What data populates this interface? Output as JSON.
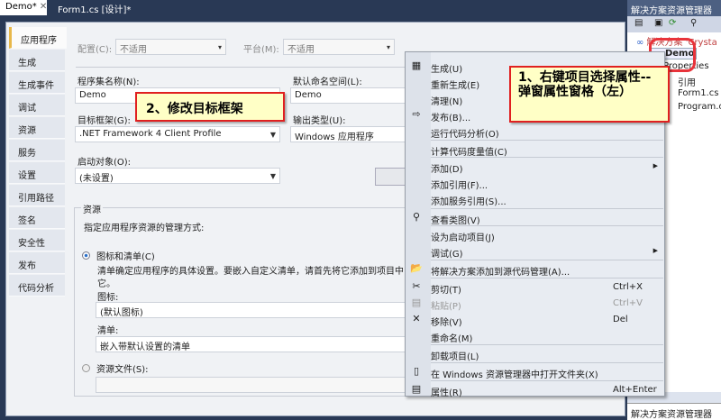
{
  "doc_tabs": [
    {
      "label": "Demo*",
      "close": "✕"
    },
    {
      "label": "Form1.cs [设计]*"
    }
  ],
  "side_tabs": [
    "应用程序",
    "生成",
    "生成事件",
    "调试",
    "资源",
    "服务",
    "设置",
    "引用路径",
    "签名",
    "安全性",
    "发布",
    "代码分析"
  ],
  "config": {
    "label": "配置(C):",
    "value": "不适用"
  },
  "platform": {
    "label": "平台(M):",
    "value": "不适用"
  },
  "assembly_name": {
    "label": "程序集名称(N):",
    "value": "Demo"
  },
  "default_namespace": {
    "label": "默认命名空间(L):",
    "value": "Demo"
  },
  "target_framework": {
    "label": "目标框架(G):",
    "value": ".NET Framework 4 Client Profile"
  },
  "output_type": {
    "label": "输出类型(U):",
    "value": "Windows 应用程序"
  },
  "startup_object": {
    "label": "启动对象(O):",
    "value": "(未设置)"
  },
  "resources": {
    "group": "资源",
    "desc": "指定应用程序资源的管理方式:",
    "radio_icon_manifest": "图标和清单(C)",
    "manifest_desc": "清单确定应用程序的具体设置。要嵌入自定义清单，请首先将它添加到项目中，然后",
    "manifest_desc2": "它。",
    "icon_label": "图标:",
    "icon_value": "(默认图标)",
    "manifest_label": "清单:",
    "manifest_value": "嵌入带默认设置的清单",
    "radio_resource_file": "资源文件(S):"
  },
  "context_menu": {
    "items": [
      {
        "label": "生成(U)",
        "icon": "build-icon"
      },
      {
        "label": "重新生成(E)"
      },
      {
        "label": "清理(N)"
      },
      {
        "label": "发布(B)...",
        "icon": "publish-icon"
      },
      {
        "label": "运行代码分析(O)"
      },
      {
        "label": "计算代码度量值(C)"
      },
      {
        "label": "添加(D)",
        "submenu": true
      },
      {
        "label": "添加引用(F)..."
      },
      {
        "label": "添加服务引用(S)..."
      },
      {
        "label": "查看类图(V)",
        "icon": "class-diagram-icon"
      },
      {
        "label": "设为启动项目(J)"
      },
      {
        "label": "调试(G)",
        "submenu": true
      },
      {
        "label": "将解决方案添加到源代码管理(A)...",
        "icon": "folder-icon"
      },
      {
        "label": "剪切(T)",
        "shortcut": "Ctrl+X",
        "icon": "scissors-icon"
      },
      {
        "label": "粘贴(P)",
        "shortcut": "Ctrl+V",
        "icon": "paste-icon",
        "disabled": true
      },
      {
        "label": "移除(V)",
        "shortcut": "Del",
        "icon": "remove-icon"
      },
      {
        "label": "重命名(M)"
      },
      {
        "label": "卸载项目(L)"
      },
      {
        "label": "在 Windows 资源管理器中打开文件夹(X)",
        "icon": "open-folder-icon"
      },
      {
        "label": "属性(R)",
        "shortcut": "Alt+Enter",
        "icon": "properties-icon"
      }
    ]
  },
  "callout1": "1、右键项目选择属性--弹窗属性窗格（左）",
  "callout2": "2、修改目标框架",
  "solution_explorer": {
    "title": "解决方案资源管理器",
    "solution": "解决方案 'Crysta",
    "project": "Demo",
    "items": [
      "Properties",
      "引用",
      "Form1.cs",
      "Program.cs"
    ],
    "footer": "解决方案资源管理器"
  },
  "colors": {
    "callout_bg": "#ffffc6",
    "callout_border": "#e02020",
    "frame": "#293955"
  }
}
